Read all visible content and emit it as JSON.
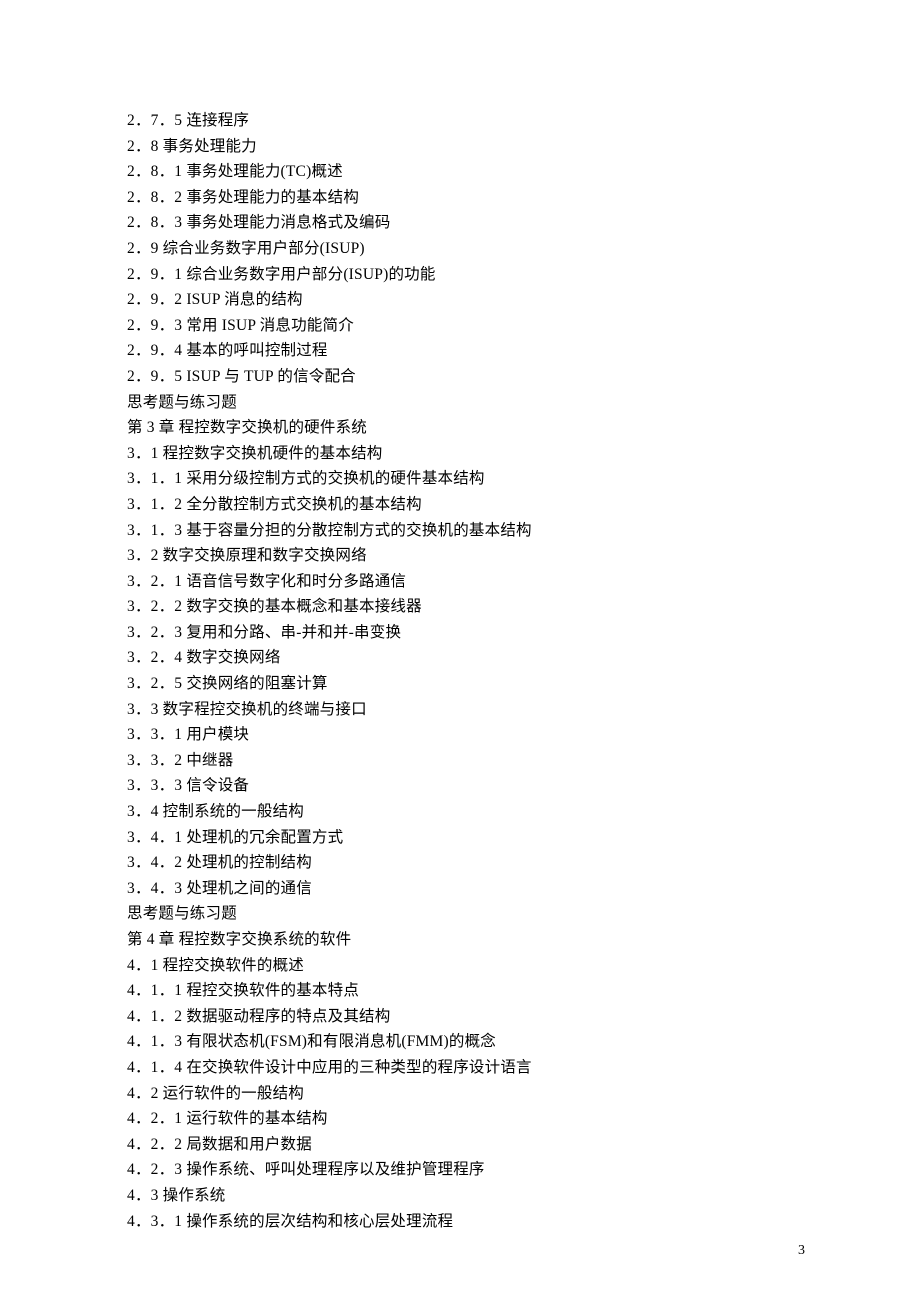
{
  "toc": {
    "lines": [
      "2．7．5 连接程序",
      "2．8 事务处理能力",
      "2．8．1 事务处理能力(TC)概述",
      "2．8．2 事务处理能力的基本结构",
      "2．8．3 事务处理能力消息格式及编码",
      "2．9   综合业务数字用户部分(ISUP)",
      "2．9．1 综合业务数字用户部分(ISUP)的功能",
      "2．9．2 ISUP 消息的结构",
      "2．9．3  常用 ISUP 消息功能简介",
      "2．9．4 基本的呼叫控制过程",
      "2．9．5 ISUP 与 TUP 的信令配合",
      "思考题与练习题",
      "第 3 章 程控数字交换机的硬件系统",
      "3．1 程控数字交换机硬件的基本结构",
      "3．1．1 采用分级控制方式的交换机的硬件基本结构",
      "3．1．2 全分散控制方式交换机的基本结构",
      "3．1．3 基于容量分担的分散控制方式的交换机的基本结构",
      "3．2 数字交换原理和数字交换网络",
      "3．2．1 语音信号数字化和时分多路通信",
      "3．2．2 数字交换的基本概念和基本接线器",
      "3．2．3  复用和分路、串-并和并-串变换",
      "3．2．4 数字交换网络",
      "3．2．5  交换网络的阻塞计算",
      "3．3 数字程控交换机的终端与接口",
      "3．3．1 用户模块",
      "3．3．2 中继器",
      "3．3．3 信令设备",
      "3．4 控制系统的一般结构",
      "3．4．1  处理机的冗余配置方式",
      "3．4．2  处理机的控制结构",
      "3．4．3  处理机之间的通信",
      "思考题与练习题",
      "第 4 章 程控数字交换系统的软件",
      "4．1 程控交换软件的概述",
      "4．1．1 程控交换软件的基本特点",
      "4．1．2 数据驱动程序的特点及其结构",
      "4．1．3  有限状态机(FSM)和有限消息机(FMM)的概念",
      "4．1．4 在交换软件设计中应用的三种类型的程序设计语言",
      "4．2 运行软件的一般结构",
      "4．2．1 运行软件的基本结构",
      "4．2．2 局数据和用户数据",
      "4．2．3 操作系统、呼叫处理程序以及维护管理程序",
      "4．3 操作系统",
      "4．3．1  操作系统的层次结构和核心层处理流程"
    ]
  },
  "page_number": "3"
}
